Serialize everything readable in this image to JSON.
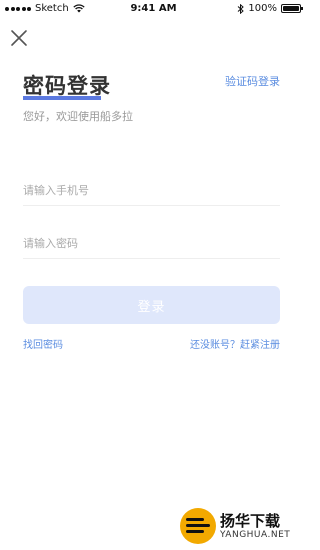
{
  "status_bar": {
    "carrier": "Sketch",
    "time": "9:41 AM",
    "battery": "100%"
  },
  "header": {
    "close_icon": "close-icon",
    "title": "密码登录",
    "alt_login_label": "验证码登录",
    "subtitle": "您好，欢迎使用船多拉"
  },
  "form": {
    "phone_placeholder": "请输入手机号",
    "phone_value": "",
    "password_placeholder": "请输入密码",
    "password_value": "",
    "login_label": "登录",
    "forgot_label": "找回密码",
    "register_label": "还没账号？赶紧注册"
  },
  "colors": {
    "accent": "#5b79e0",
    "link": "#5b8de0",
    "button_disabled": "#dfe7fb"
  },
  "watermark": {
    "text_cn": "扬华下载",
    "text_en": "YANGHUA.NET"
  }
}
